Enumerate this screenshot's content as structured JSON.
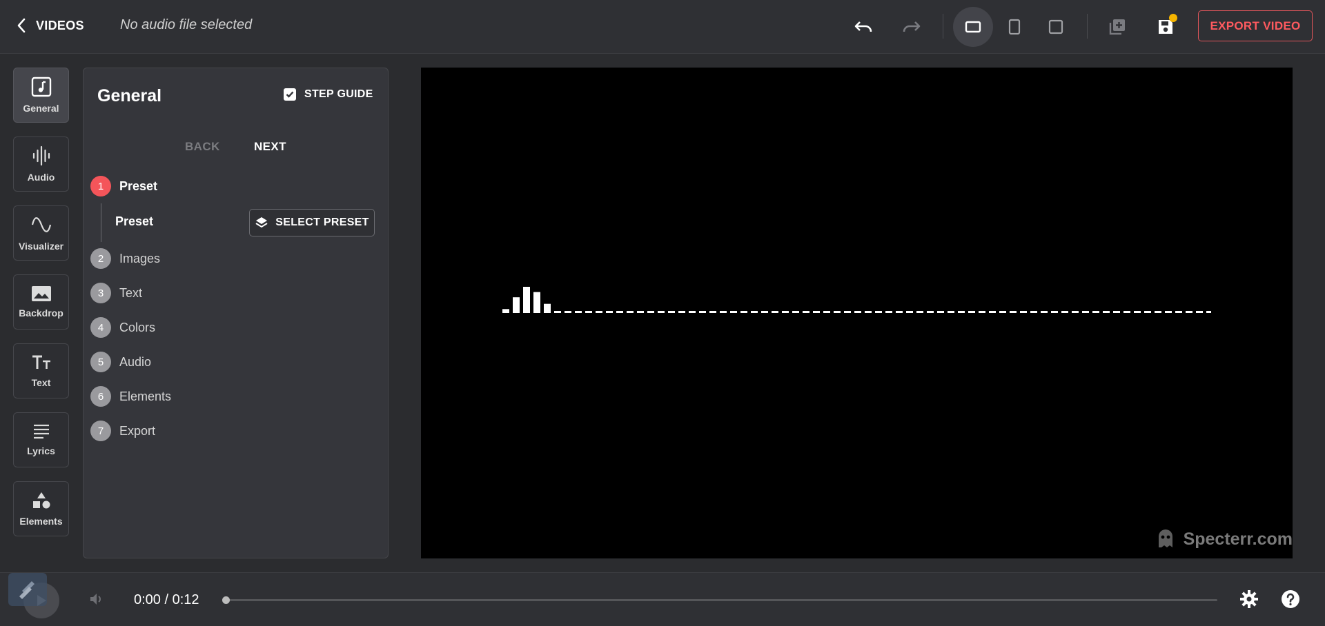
{
  "header": {
    "back_label": "VIDEOS",
    "audio_status": "No audio file selected",
    "export_label": "EXPORT VIDEO",
    "toolbar_icons": [
      "undo-icon",
      "redo-icon",
      "landscape-format-icon",
      "portrait-format-icon",
      "square-format-icon",
      "add-layer-icon",
      "save-icon"
    ],
    "active_format": "landscape",
    "save_indicator_color": "#f5b400",
    "accent_color": "#ff5a5f"
  },
  "sidebar": {
    "items": [
      {
        "label": "General",
        "icon": "music-note-icon",
        "active": true
      },
      {
        "label": "Audio",
        "icon": "audio-wave-icon",
        "active": false
      },
      {
        "label": "Visualizer",
        "icon": "sine-wave-icon",
        "active": false
      },
      {
        "label": "Backdrop",
        "icon": "image-icon",
        "active": false
      },
      {
        "label": "Text",
        "icon": "text-size-icon",
        "active": false
      },
      {
        "label": "Lyrics",
        "icon": "lyrics-icon",
        "active": false
      },
      {
        "label": "Elements",
        "icon": "shapes-icon",
        "active": false
      }
    ]
  },
  "panel": {
    "title": "General",
    "step_guide_label": "STEP GUIDE",
    "step_guide_checked": true,
    "back_label": "BACK",
    "next_label": "NEXT",
    "steps": [
      {
        "num": "1",
        "label": "Preset",
        "active": true
      },
      {
        "num": "2",
        "label": "Images",
        "active": false
      },
      {
        "num": "3",
        "label": "Text",
        "active": false
      },
      {
        "num": "4",
        "label": "Colors",
        "active": false
      },
      {
        "num": "5",
        "label": "Audio",
        "active": false
      },
      {
        "num": "6",
        "label": "Elements",
        "active": false
      },
      {
        "num": "7",
        "label": "Export",
        "active": false
      }
    ],
    "sub_label": "Preset",
    "select_preset_label": "SELECT PRESET"
  },
  "preview": {
    "watermark": "Specterr.com",
    "bar_levels": [
      0.15,
      0.6,
      1.0,
      0.8,
      0.35
    ]
  },
  "player": {
    "time": "0:00 / 0:12",
    "progress": 0
  }
}
